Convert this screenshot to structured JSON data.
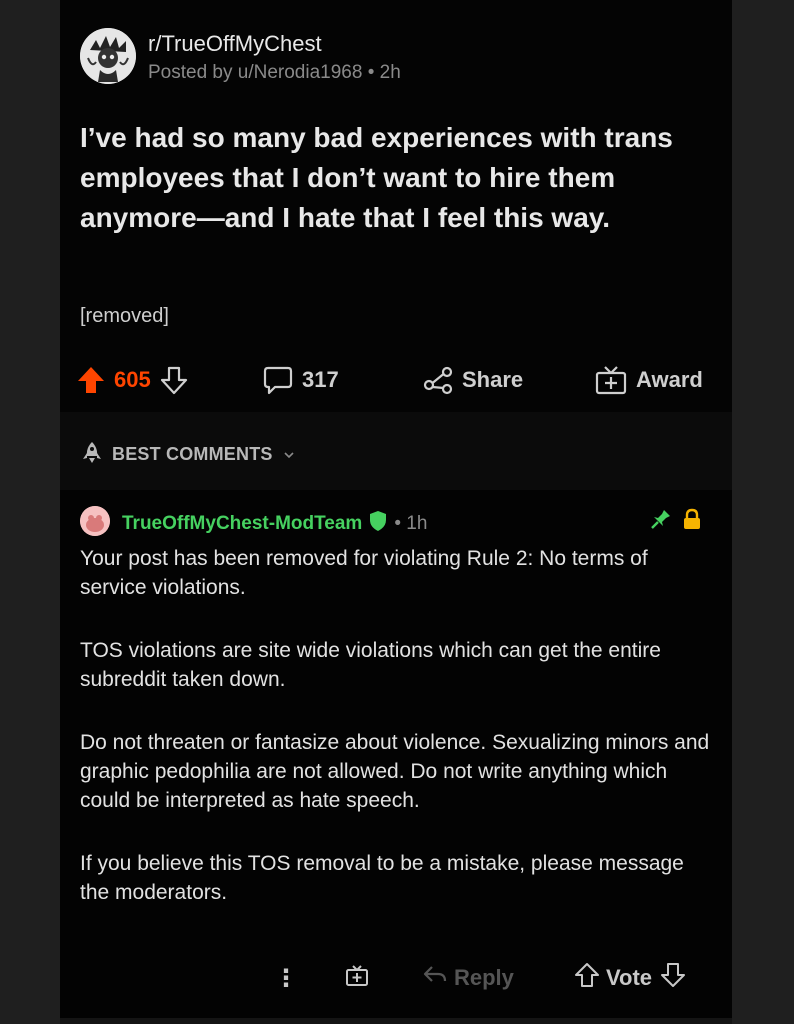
{
  "post": {
    "subreddit": "r/TrueOffMyChest",
    "byline": "Posted by u/Nerodia1968 • 2h",
    "title": "I’ve had so many bad experiences with trans employees that I don’t want to hire them anymore—and I hate that I feel this way.",
    "body": "[removed]",
    "vote_count": "605",
    "comment_count": "317",
    "share_label": "Share",
    "award_label": "Award"
  },
  "sort": {
    "label": "BEST COMMENTS"
  },
  "comment": {
    "author": "TrueOffMyChest-ModTeam",
    "time": "• 1h",
    "paragraphs": [
      "Your post has been removed for violating Rule 2: No terms of service violations.",
      "TOS violations are site wide violations which can get the entire subreddit taken down.",
      "Do not threaten or fantasize about violence. Sexualizing minors and graphic pedophilia are not allowed. Do not write anything which could be interpreted as hate speech.",
      "If you believe this TOS removal to be a mistake, please message the moderators."
    ],
    "more_label": "⋮",
    "reply_label": "Reply",
    "vote_label": "Vote"
  },
  "colors": {
    "upvote": "#ff4500",
    "mod_green": "#46d160",
    "background": "#030303"
  },
  "icons": {
    "upvote": "upvote-arrow-icon",
    "downvote": "downvote-arrow-icon",
    "comments": "speech-bubble-icon",
    "share": "share-icon",
    "award": "gift-icon",
    "sort": "rocket-icon",
    "mod": "shield-icon",
    "pin": "pin-icon",
    "lock": "lock-icon"
  }
}
